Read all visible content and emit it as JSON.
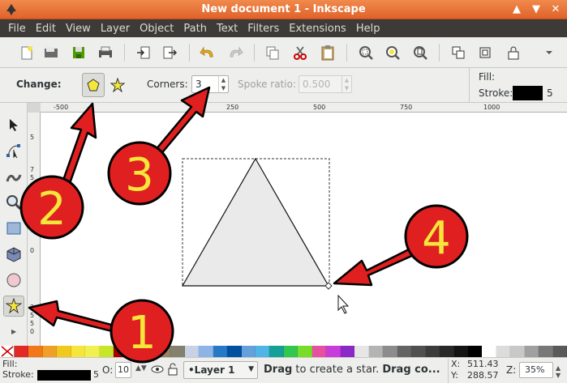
{
  "window": {
    "title": "New document 1 - Inkscape",
    "buttons": [
      "▲",
      "▼",
      "✕"
    ]
  },
  "menu": [
    "File",
    "Edit",
    "View",
    "Layer",
    "Object",
    "Path",
    "Text",
    "Filters",
    "Extensions",
    "Help"
  ],
  "controls": {
    "change_label": "Change:",
    "corners_label": "Corners:",
    "corners_value": "3",
    "spoke_label": "Spoke ratio:",
    "spoke_value": "0.500",
    "fill_label": "Fill:",
    "stroke_label": "Stroke:",
    "stroke_width": "5"
  },
  "ruler": {
    "h_labels": [
      "-500",
      "250",
      "500",
      "750",
      "1000"
    ],
    "v_labels": [
      "5",
      "7",
      "5",
      "0",
      "2",
      "5",
      "5",
      "0"
    ]
  },
  "annotations": [
    "1",
    "2",
    "3",
    "4"
  ],
  "status": {
    "fill_label": "Fill:",
    "stroke_label": "Stroke:",
    "stroke_width": "5",
    "opacity_label": "O:",
    "opacity_value": "10",
    "layer": "•Layer 1",
    "message_bold": "Drag",
    "message_rest": " to create a star. ",
    "message_bold2": "Drag co...",
    "x_label": "X:",
    "x_value": "511.43",
    "y_label": "Y:",
    "y_value": "288.57",
    "zoom_label": "Z:",
    "zoom_value": "35%"
  },
  "palette_colors": [
    "#e32828",
    "#f07818",
    "#f0a028",
    "#f0c81e",
    "#f5e63c",
    "#f0f050",
    "#c8e628",
    "#a50000",
    "#d2b48c",
    "#b9a07d",
    "#9b8264",
    "#82826e",
    "#c8d2e6",
    "#8cb4e6",
    "#2878c8",
    "#0050a0",
    "#64a0dc",
    "#50b4e6",
    "#14a096",
    "#32c850",
    "#78dc28",
    "#e650a0",
    "#c83cdc",
    "#8c28c8",
    "#e6e6e6",
    "#b4b4b4",
    "#8c8c8c",
    "#646464",
    "#505050",
    "#3c3c3c",
    "#282828",
    "#141414",
    "#000000",
    "#ffffff",
    "#dcdcdc",
    "#c8c8c8",
    "#a0a0a0",
    "#787878",
    "#5a5a5a"
  ]
}
